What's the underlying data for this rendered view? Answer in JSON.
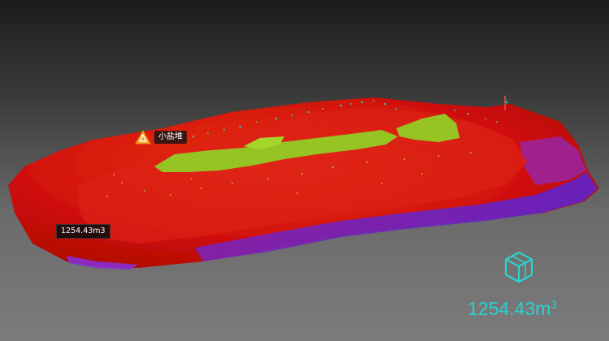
{
  "marker": {
    "label": "小盐堆",
    "icon": "warning-triangle-icon",
    "icon_color": "#f6a12a"
  },
  "measurement": {
    "tag_text": "1254.43m3",
    "readout_value": "1254.43m",
    "readout_unit_superscript": "3",
    "readout_color": "#27d3d3",
    "icon": "cube-volume-icon"
  },
  "colors": {
    "cloud_high": "#e41914",
    "cloud_peak": "#a4d62a",
    "cloud_low": "#7b2bd9",
    "sparkle": "#2fd7c4"
  }
}
